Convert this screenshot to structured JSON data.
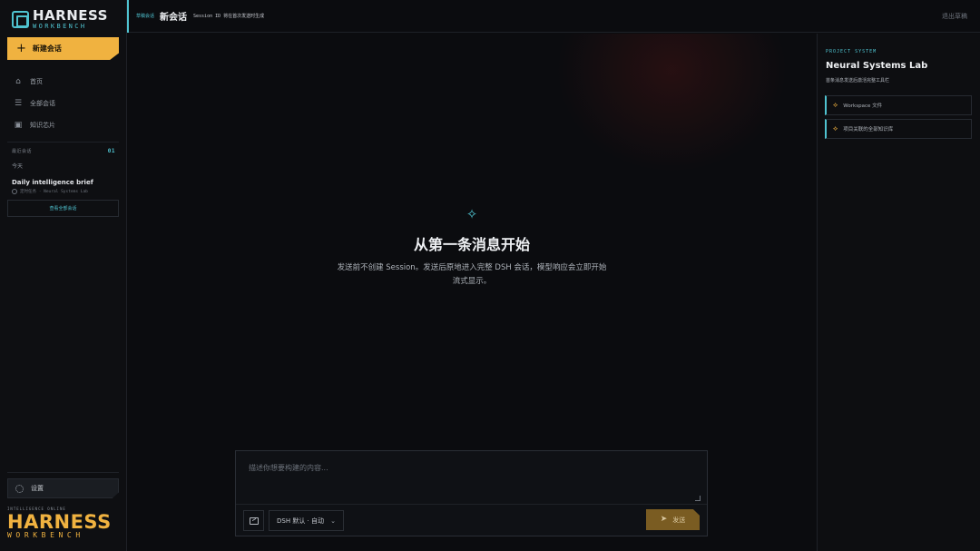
{
  "app": {
    "logo_title": "HARNESS",
    "logo_sub": "WORKBENCH"
  },
  "sidebar": {
    "new_chat": "新建会话",
    "nav": [
      {
        "label": "首页",
        "icon": "home-icon"
      },
      {
        "label": "全部会话",
        "icon": "list-icon"
      },
      {
        "label": "知识芯片",
        "icon": "chip-icon"
      }
    ],
    "recent": {
      "heading": "最近会话",
      "count": "01",
      "group": "今天",
      "item_title": "Daily intelligence brief",
      "item_meta": "定时任务 · Neural Systems Lab",
      "view_all": "查看全部会话"
    },
    "settings": "设置",
    "brand_tag": "INTELLIGENCE ONLINE",
    "brand_big": "HARNESS",
    "brand_small": "WORKBENCH"
  },
  "topbar": {
    "crumb": "草稿会话",
    "title": "新会话",
    "session_note": "Session ID 将在首次发送时生成",
    "exit": "退出草稿"
  },
  "main": {
    "hero_title": "从第一条消息开始",
    "hero_desc": "发送前不创建 Session。发送后原地进入完整 DSH 会话，模型响应会立即开始流式显示。",
    "composer_placeholder": "描述你想要构建的内容...",
    "model_select": "DSH 默认 · 自动",
    "send": "发送"
  },
  "right_panel": {
    "tag": "PROJECT SYSTEM",
    "title": "Neural Systems Lab",
    "desc": "首条消息发送后激活完整工具栏",
    "links": [
      "Workspace 文件",
      "项目关联的全部知识库"
    ]
  },
  "colors": {
    "accent_cyan": "#4fc3d0",
    "accent_amber": "#f0b240",
    "background": "#0b0c0f"
  }
}
